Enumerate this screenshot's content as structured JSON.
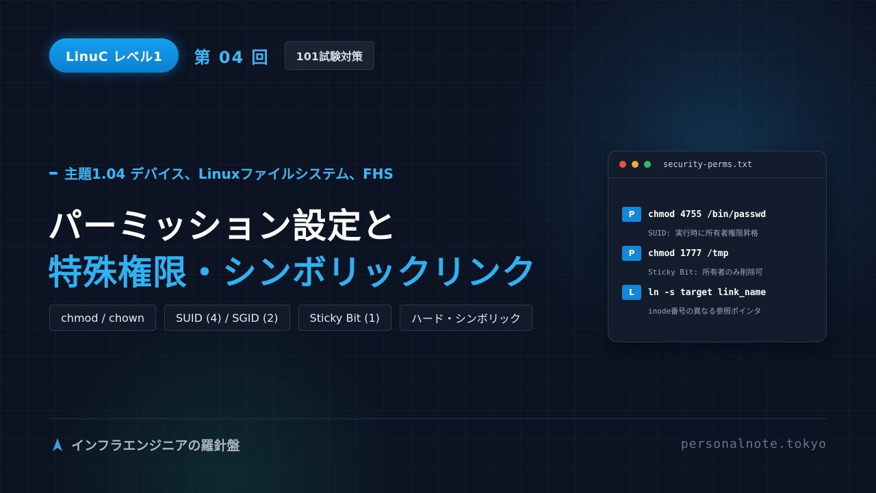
{
  "header": {
    "level_label": "LinuC レベル1",
    "episode_label": "第 04 回",
    "exam_label": "101試験対策"
  },
  "subtitle": "主題1.04 デバイス、Linuxファイルシステム、FHS",
  "title": {
    "line1": "パーミッション設定と",
    "line2": "特殊権限・シンボリックリンク"
  },
  "tags": [
    "chmod / chown",
    "SUID (4) / SGID (2)",
    "Sticky Bit (1)",
    "ハード・シンボリック"
  ],
  "terminal": {
    "filename": "security-perms.txt",
    "commands": [
      {
        "badge": "P",
        "cmd": "chmod 4755 /bin/passwd",
        "desc": "SUID: 実行時に所有者権限昇格"
      },
      {
        "badge": "P",
        "cmd": "chmod 1777 /tmp",
        "desc": "Sticky Bit: 所有者のみ削除可"
      },
      {
        "badge": "L",
        "cmd": "ln -s target link_name",
        "desc": "inode番号の異なる参照ポインタ"
      }
    ]
  },
  "footer": {
    "brand": "インフラエンジニアの羅針盤",
    "site": "personalnote.tokyo"
  },
  "colors": {
    "accent": "#2fb2f4",
    "background": "#0c1322",
    "badge": "#1488d8"
  },
  "icons": {
    "brand": "compass-arrow-icon"
  }
}
